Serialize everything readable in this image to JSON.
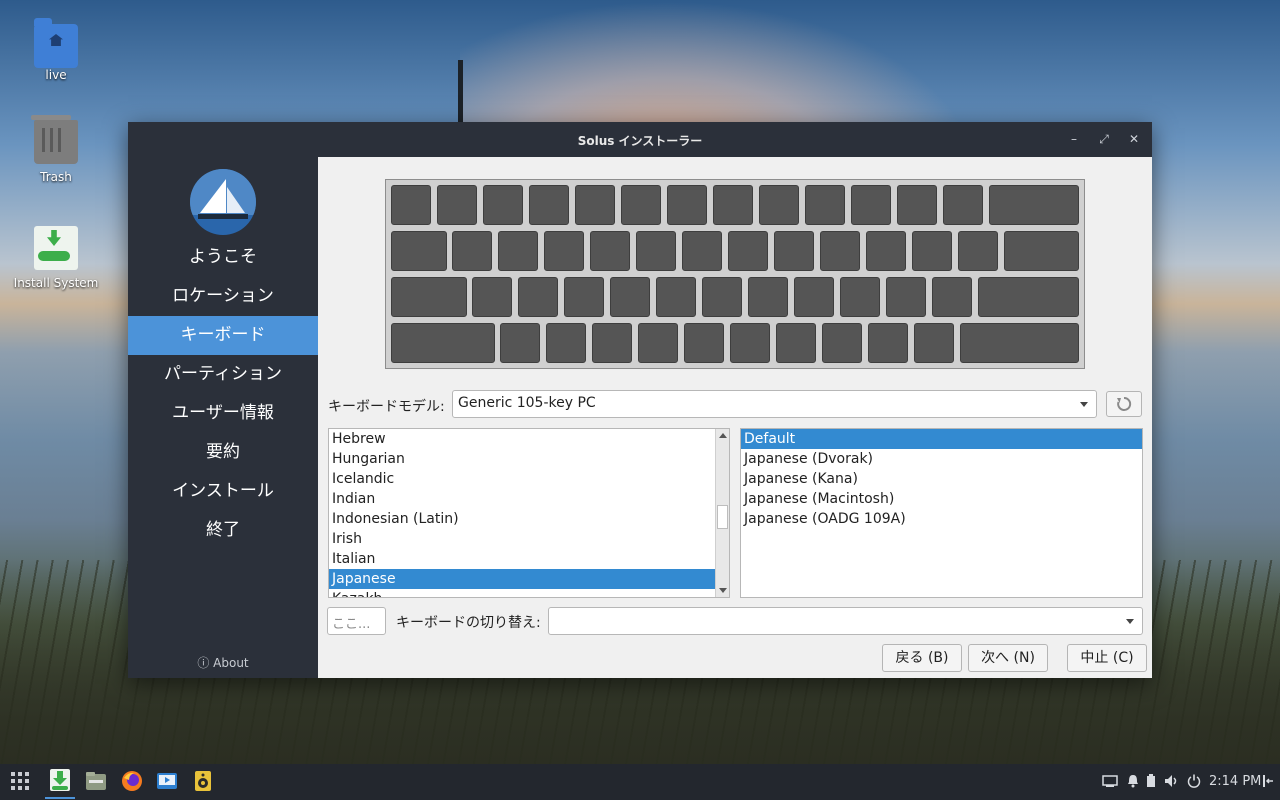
{
  "desktop": {
    "icons": [
      {
        "label": "live",
        "icon": "home-folder-icon"
      },
      {
        "label": "Trash",
        "icon": "trash-icon"
      },
      {
        "label": "Install System",
        "icon": "install-system-icon"
      }
    ]
  },
  "window": {
    "title": "Solus インストーラー",
    "controls": {
      "minimize": "–",
      "maximize": "⤢",
      "close": "✕"
    }
  },
  "sidebar": {
    "items": [
      {
        "label": "ようこそ",
        "active": false
      },
      {
        "label": "ロケーション",
        "active": false
      },
      {
        "label": "キーボード",
        "active": true
      },
      {
        "label": "パーティション",
        "active": false
      },
      {
        "label": "ユーザー情報",
        "active": false
      },
      {
        "label": "要約",
        "active": false
      },
      {
        "label": "インストール",
        "active": false
      },
      {
        "label": "終了",
        "active": false
      }
    ],
    "about": "ⓘ About"
  },
  "keyboard": {
    "model_label": "キーボードモデル:",
    "model_value": "Generic 105-key PC",
    "layouts": [
      "Hebrew",
      "Hungarian",
      "Icelandic",
      "Indian",
      "Indonesian (Latin)",
      "Irish",
      "Italian",
      "Japanese",
      "Kazakh"
    ],
    "selected_layout": "Japanese",
    "variants": [
      "Default",
      "Japanese (Dvorak)",
      "Japanese (Kana)",
      "Japanese (Macintosh)",
      "Japanese (OADG 109A)"
    ],
    "selected_variant": "Default",
    "test_placeholder": "ここ...",
    "switch_label": "キーボードの切り替え:",
    "switch_value": ""
  },
  "buttons": {
    "back": "戻る (B)",
    "next": "次へ (N)",
    "cancel": "中止 (C)"
  },
  "taskbar": {
    "time": "2:14 PM"
  },
  "colors": {
    "accent": "#4c93d9",
    "selection": "#338ad1",
    "sidebar_bg": "#2b303a",
    "key_fill": "#555555"
  }
}
